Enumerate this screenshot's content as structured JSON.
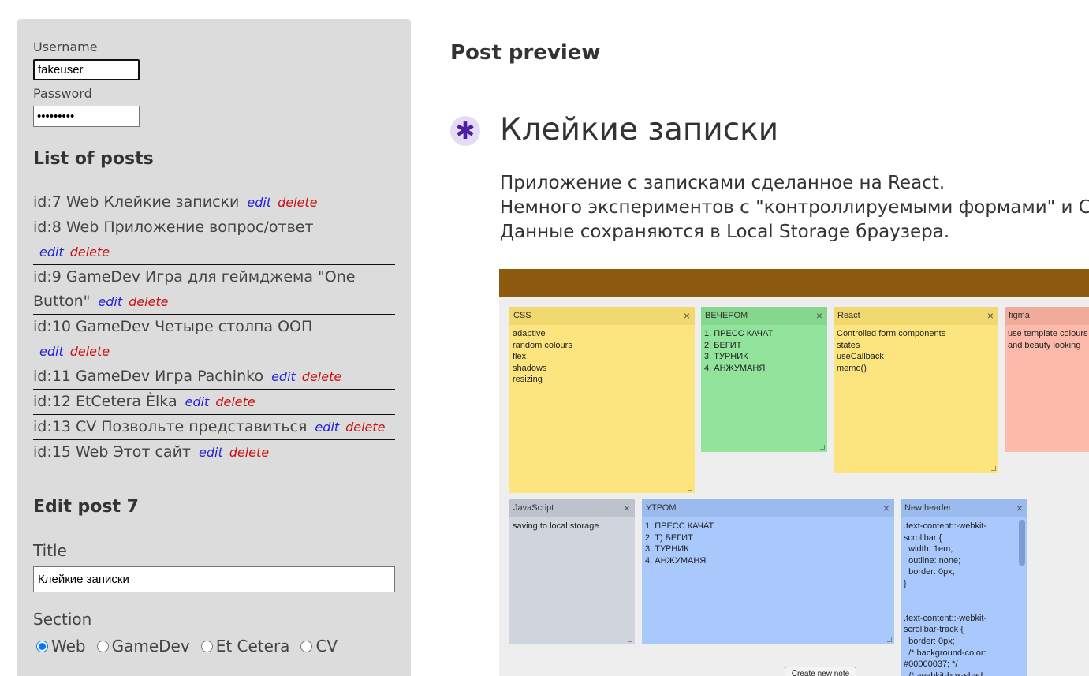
{
  "login": {
    "username_label": "Username",
    "username_value": "fakeuser",
    "password_label": "Password",
    "password_value": "•••••••••"
  },
  "posts_heading": "List of posts",
  "posts": [
    {
      "text": "id:7 Web Клейкие записки",
      "edit": "edit",
      "delete": "delete"
    },
    {
      "text": "id:8 Web Приложение вопрос/ответ",
      "edit": "edit",
      "delete": "delete"
    },
    {
      "text": "id:9 GameDev Игра для геймджема \"One Button\"",
      "edit": "edit",
      "delete": "delete"
    },
    {
      "text": "id:10 GameDev Четыре столпа ООП",
      "edit": "edit",
      "delete": "delete"
    },
    {
      "text": "id:11 GameDev Игра Pachinko",
      "edit": "edit",
      "delete": "delete"
    },
    {
      "text": "id:12 EtCetera Èlka",
      "edit": "edit",
      "delete": "delete"
    },
    {
      "text": "id:13 CV Позвольте представиться",
      "edit": "edit",
      "delete": "delete"
    },
    {
      "text": "id:15 Web Этот сайт",
      "edit": "edit",
      "delete": "delete"
    }
  ],
  "editor": {
    "heading": "Edit post 7",
    "title_label": "Title",
    "title_value": "Клейкие записки",
    "section_label": "Section",
    "sections": [
      {
        "label": "Web",
        "selected": true
      },
      {
        "label": "GameDev",
        "selected": false
      },
      {
        "label": "Et Cetera",
        "selected": false
      },
      {
        "label": "CV",
        "selected": false
      }
    ]
  },
  "preview": {
    "heading": "Post preview",
    "bullet_glyph": "✱",
    "title": "Клейкие записки",
    "body_lines": [
      "Приложение с записками сделанное на React.",
      "Немного экспериментов с \"контроллируемыми формами\" и C",
      "Данные сохраняются в Local Storage браузера."
    ]
  },
  "screenshot": {
    "colors": {
      "topbar": "#8d5a10",
      "yellow": "#fce57e",
      "green": "#92e39b",
      "salmon": "#fdbaaa",
      "gray": "#cfd4dd",
      "blue": "#a9c8fb"
    },
    "close_glyph": "×",
    "create_button": "Create new note",
    "notes": [
      {
        "id": "css",
        "header": "CSS",
        "body": "adaptive\nrandom colours\nflex\nshadows\nresizing"
      },
      {
        "id": "evening",
        "header": "ВЕЧЕРОМ",
        "body": "1. ПРЕСС КАЧАТ\n2. БЕГИТ\n3. ТУРНИК\n4. АНЖУМАНЯ"
      },
      {
        "id": "react",
        "header": "React",
        "body": "Controlled form components\nstates\nuseCallback\nmemo()"
      },
      {
        "id": "figma",
        "header": "figma",
        "body": "use template colours\nand beauty looking"
      },
      {
        "id": "js",
        "header": "JavaScript",
        "body": "saving to local storage"
      },
      {
        "id": "morning",
        "header": "УТРОМ",
        "body": "1. ПРЕСС КАЧАТ\n2. Т) БЕГИТ\n3. ТУРНИК\n4. АНЖУМАНЯ"
      },
      {
        "id": "newheader",
        "header": "New header",
        "body": ".text-content::-webkit-\nscrollbar {\n  width: 1em;\n  outline: none;\n  border: 0px;\n}\n\n\n.text-content::-webkit-\nscrollbar-track {\n  border: 0px;\n  /* background-color:\n#00000037; */\n  /* -webkit-box-shad"
      }
    ]
  }
}
